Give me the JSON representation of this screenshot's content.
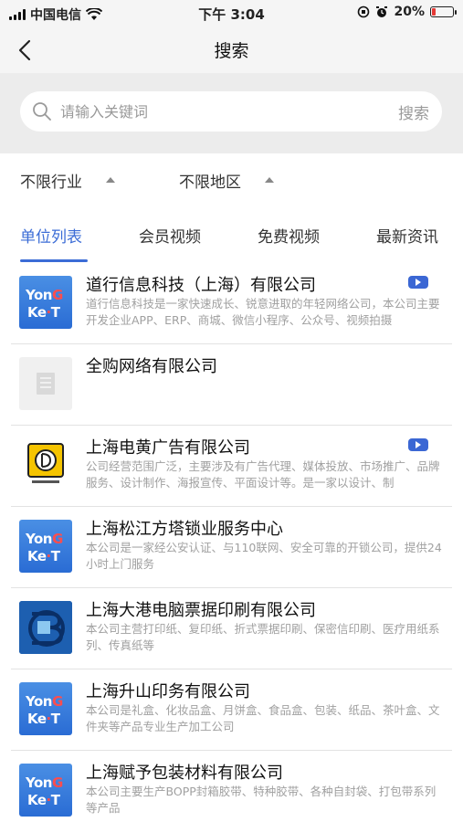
{
  "status_bar": {
    "carrier": "中国电信",
    "time": "下午 3:04",
    "battery": "20%",
    "battery_level": 0.2
  },
  "nav": {
    "title": "搜索"
  },
  "search": {
    "placeholder": "请输入关键词",
    "button_label": "搜索"
  },
  "filters": {
    "industry": "不限行业",
    "region": "不限地区"
  },
  "tabs": [
    {
      "label": "单位列表",
      "active": true
    },
    {
      "label": "会员视频",
      "active": false
    },
    {
      "label": "免费视频",
      "active": false
    },
    {
      "label": "最新资讯",
      "active": false
    }
  ],
  "companies": [
    {
      "name": "道行信息科技（上海）有限公司",
      "desc": "道行信息科技是一家快速成长、锐意进取的年轻网络公司，本公司主要开发企业APP、ERP、商城、微信小程序、公众号、视频拍摄",
      "logo": "yongke-logo",
      "has_video": true
    },
    {
      "name": "全购网络有限公司",
      "desc": "",
      "logo": "placeholder-building-icon",
      "has_video": false
    },
    {
      "name": "上海电黄广告有限公司",
      "desc": "公司经营范围广泛，主要涉及有广告代理、媒体投放、市场推广、品牌服务、设计制作、海报宣传、平面设计等。是一家以设计、制",
      "logo": "dianhuang-logo",
      "has_video": true
    },
    {
      "name": "上海松江方塔锁业服务中心",
      "desc": "本公司是一家经公安认证、与110联网、安全可靠的开锁公司，提供24小时上门服务",
      "logo": "yongke-logo",
      "has_video": false
    },
    {
      "name": "上海大港电脑票据印刷有限公司",
      "desc": "本公司主营打印纸、复印纸、折式票据印刷、保密信印刷、医疗用纸系列、传真纸等",
      "logo": "dagang-logo",
      "has_video": false
    },
    {
      "name": "上海升山印务有限公司",
      "desc": "本公司是礼盒、化妆品盒、月饼盒、食品盒、包装、纸品、茶叶盒、文件夹等产品专业生产加工公司",
      "logo": "yongke-logo",
      "has_video": false
    },
    {
      "name": "上海赋予包装材料有限公司",
      "desc": "本公司主要生产BOPP封箱胶带、特种胶带、各种自封袋、打包带系列等产品",
      "logo": "yongke-logo",
      "has_video": false
    }
  ],
  "logo_text": {
    "yongke_line1_a": "Yon",
    "yongke_line1_b": "G",
    "yongke_line2_a": "Ke",
    "yongke_line2_b": "·",
    "yongke_line2_c": "T"
  },
  "colors": {
    "accent": "#3b6cd6",
    "video_badge": "#3b67d4",
    "battery_low": "#e53935"
  }
}
